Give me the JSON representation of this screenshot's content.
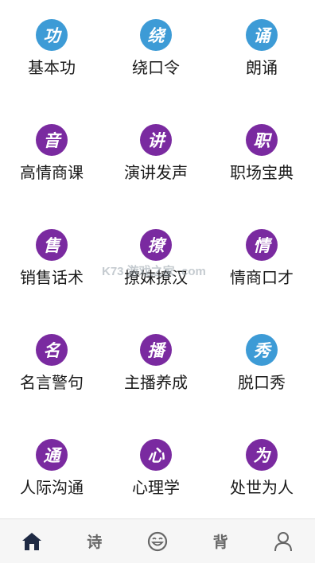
{
  "grid": {
    "items": [
      {
        "label": "基本功",
        "glyph": "功",
        "color": "#3d9bd6"
      },
      {
        "label": "绕口令",
        "glyph": "绕",
        "color": "#3d9bd6"
      },
      {
        "label": "朗诵",
        "glyph": "诵",
        "color": "#3d9bd6"
      },
      {
        "label": "高情商课",
        "glyph": "音",
        "color": "#7a2aa0"
      },
      {
        "label": "演讲发声",
        "glyph": "讲",
        "color": "#7a2aa0"
      },
      {
        "label": "职场宝典",
        "glyph": "职",
        "color": "#7a2aa0"
      },
      {
        "label": "销售话术",
        "glyph": "售",
        "color": "#7a2aa0"
      },
      {
        "label": "撩妹撩汉",
        "glyph": "撩",
        "color": "#7a2aa0"
      },
      {
        "label": "情商口才",
        "glyph": "情",
        "color": "#7a2aa0"
      },
      {
        "label": "名言警句",
        "glyph": "名",
        "color": "#7a2aa0"
      },
      {
        "label": "主播养成",
        "glyph": "播",
        "color": "#7a2aa0"
      },
      {
        "label": "脱口秀",
        "glyph": "秀",
        "color": "#3d9bd6"
      },
      {
        "label": "人际沟通",
        "glyph": "通",
        "color": "#7a2aa0"
      },
      {
        "label": "心理学",
        "glyph": "心",
        "color": "#7a2aa0"
      },
      {
        "label": "处世为人",
        "glyph": "为",
        "color": "#7a2aa0"
      }
    ]
  },
  "watermark": "K73 游戏之家 .com",
  "tabbar": {
    "tabs": [
      {
        "name": "home",
        "icon": "home-icon",
        "active": true
      },
      {
        "name": "poem",
        "label": "诗"
      },
      {
        "name": "face",
        "icon": "smiley-face-icon"
      },
      {
        "name": "recite",
        "label": "背"
      },
      {
        "name": "profile",
        "icon": "user-icon"
      }
    ],
    "active_color": "#1f2a44",
    "inactive_color": "#666666"
  }
}
